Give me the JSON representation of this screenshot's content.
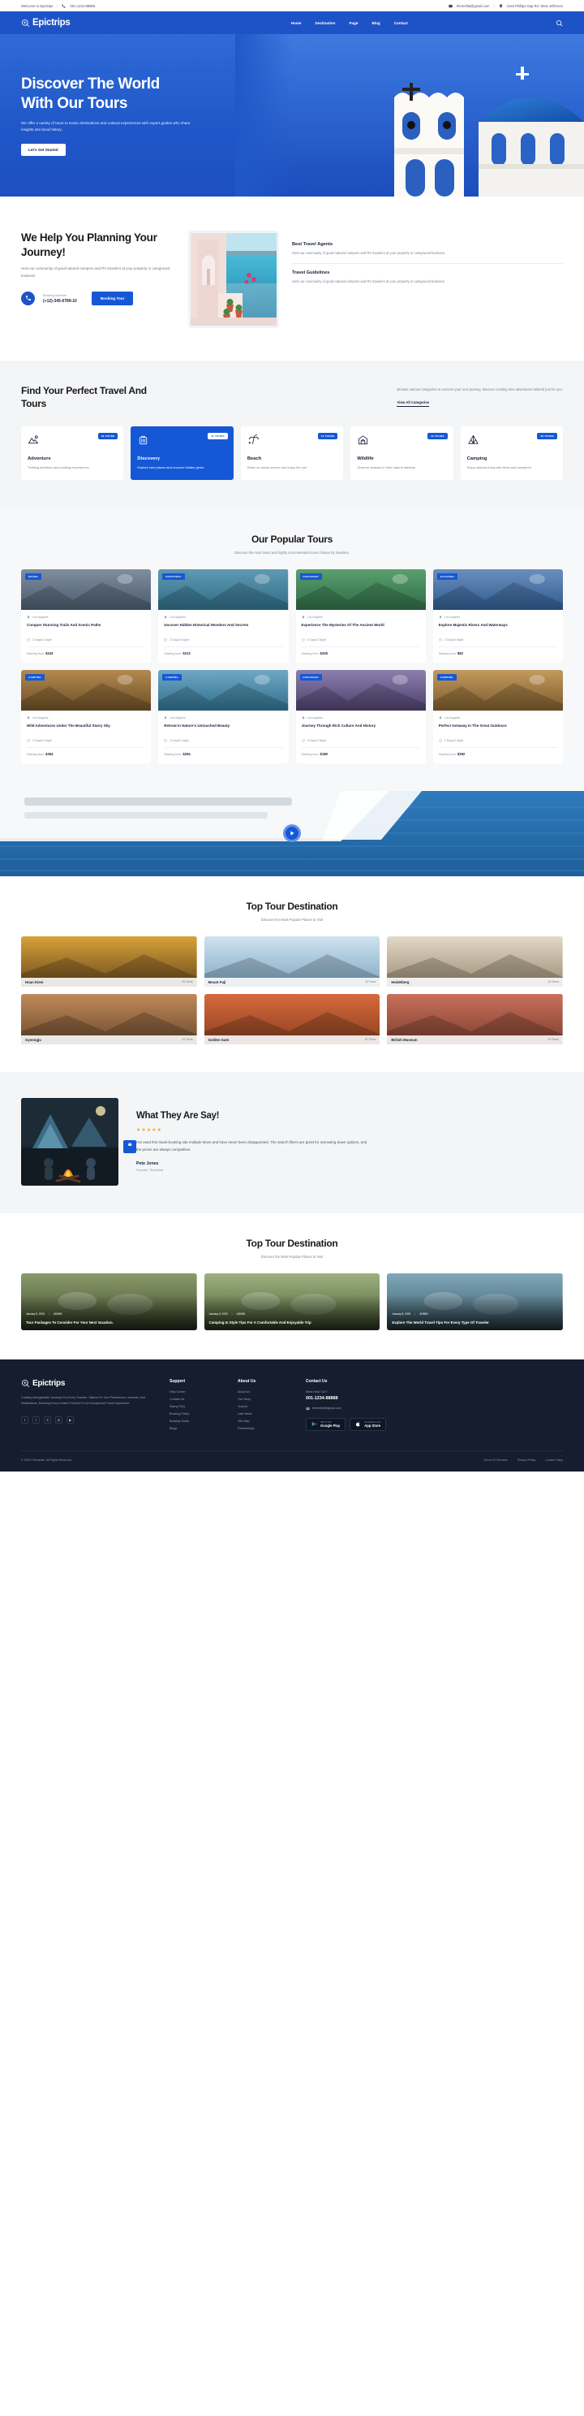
{
  "topbar": {
    "welcome": "Welcome to Epictrips",
    "phone": "001-1234-88888",
    "email": "themeflat@gmail.com",
    "address": "2163 Phillips Gap Rd. West Jefferson"
  },
  "nav": {
    "brand": "Epictrips",
    "links": [
      "Home",
      "Destination",
      "Page",
      "Blog",
      "Contact"
    ]
  },
  "hero": {
    "title_line1": "Discover The World",
    "title_line2": "With Our Tours",
    "subtitle": "We offer a variety of tours to exotic destinations and cultural experiences with expert guides who share insights into local history.",
    "cta": "Let's Get Started"
  },
  "help": {
    "title": "We Help You Planning Your Journey!",
    "body": "Host our community of good-natured campers and RV travelers at your property or camground business",
    "booking_label": "Booking Number",
    "booking_number": "(+12)-345-6789-10",
    "booking_button": "Booking Tour",
    "features": [
      {
        "title": "Best Travel Agents",
        "body": "Host our community of good-natured campers and RV travelers at your property or camground business"
      },
      {
        "title": "Travel Guidelines",
        "body": "Host our community of good-natured campers and RV travelers at your property or camground business"
      }
    ]
  },
  "categories": {
    "title": "Find Your Perfect Travel And Tours",
    "description": "Browse various categories to uncover your next journey, discover exciting new adventures tailored just for you.",
    "view_all": "View All Categories",
    "items": [
      {
        "icon": "mountain-icon",
        "badge": "28 TOURS",
        "title": "Adventure",
        "desc": "Thrilling activities and exciting experiences.",
        "active": false
      },
      {
        "icon": "suitcase-icon",
        "badge": "32 TOURS",
        "title": "Discovery",
        "desc": "Explore new places and uncover hidden gems.",
        "active": true
      },
      {
        "icon": "palm-tree-icon",
        "badge": "12 TOURS",
        "title": "Beach",
        "desc": "Relax on sandy shores and enjoy the sun.",
        "active": false
      },
      {
        "icon": "barn-icon",
        "badge": "42 TOURS",
        "title": "Wildlife",
        "desc": "Observe animals in their natural habitats.",
        "active": false
      },
      {
        "icon": "tent-icon",
        "badge": "48 TOURS",
        "title": "Camping",
        "desc": "Enjoy outdoor living with tents and campfires.",
        "active": false
      }
    ]
  },
  "popular": {
    "title": "Our Popular Tours",
    "subtitle": "Discover the most loved and highly recommended tours chosen by travelers.",
    "tours": [
      {
        "tag": "HIKING",
        "location": "Los Angeles",
        "title": "Conquer Stunning Trails And Scenic Paths",
        "days": "3 Days/2 Night",
        "price_label": "Starting from:",
        "price": "$243"
      },
      {
        "tag": "DISCOVERY",
        "location": "Los Angeles",
        "title": "Uncover Hidden Historical Wonders And Secrets",
        "days": "3 Days/2 Night",
        "price_label": "Starting from:",
        "price": "$213"
      },
      {
        "tag": "DISCOVERY",
        "location": "Los Angeles",
        "title": "Experience The Mysteries Of The Ancient World",
        "days": "3 Days/2 Night",
        "price_label": "Starting from:",
        "price": "$325"
      },
      {
        "tag": "KAYAKING",
        "location": "Los Angeles",
        "title": "Explore Majestic Rivers And Waterways",
        "days": "2 Days/3 Night",
        "price_label": "Starting from:",
        "price": "$82"
      },
      {
        "tag": "CAMPING",
        "location": "Los Angeles",
        "title": "Wild Adventures Under The Beautiful Starry Sky",
        "days": "3 Days/2 Night",
        "price_label": "Starting from:",
        "price": "$354"
      },
      {
        "tag": "CAMPING",
        "location": "Los Angeles",
        "title": "Retreat In Nature's Untouched Beauty",
        "days": "3 Days/2 Night",
        "price_label": "Starting from:",
        "price": "$254"
      },
      {
        "tag": "DISCOVERY",
        "location": "Los Angeles",
        "title": "Journey Through Rich Culture And History",
        "days": "3 Days/2 Night",
        "price_label": "Starting from:",
        "price": "$180"
      },
      {
        "tag": "CAMPING",
        "location": "Los Angeles",
        "title": "Perfect Getaway In The Great Outdoors",
        "days": "2 Days/3 Night",
        "price_label": "Starting from:",
        "price": "$392"
      }
    ]
  },
  "destination": {
    "title": "Top Tour Destination",
    "subtitle": "Discover the Most Popular Places to Visit",
    "items": [
      {
        "name": "Hoan Kiem",
        "count": "26 Tours"
      },
      {
        "name": "Mount Fuji",
        "count": "32 Tours"
      },
      {
        "name": "Heidelberg",
        "count": "42 Tours"
      },
      {
        "name": "Gyeongju",
        "count": "33 Tours"
      },
      {
        "name": "Golden Gate",
        "count": "87 Tours"
      },
      {
        "name": "British Museum",
        "count": "42 Tours"
      }
    ]
  },
  "testimonial": {
    "title": "What They Are Say!",
    "stars": "★★★★★",
    "quote": "I've used this travel booking site multiple times and have never been disappointed. The search filters are great for narrowing down options, and the prices are always competitive.",
    "name": "Pete Jones",
    "role": "Founder, Themeflat",
    "quote_mark": "❝"
  },
  "blog": {
    "title": "Top Tour Destination",
    "subtitle": "Discover the Most Popular Places to Visit",
    "posts": [
      {
        "date": "January 8, 2025",
        "author": "ADMIN",
        "title": "Tour Packages To Consider For Your Next Vacation."
      },
      {
        "date": "January 8, 2025",
        "author": "ADMIN",
        "title": "Camping In Style Tips For A Comfortable And Enjoyable Trip"
      },
      {
        "date": "January 8, 2025",
        "author": "ADMIN",
        "title": "Explore The World Travel Tips For Every Type Of Traveler"
      }
    ]
  },
  "footer": {
    "brand": "Epictrips",
    "about": "Crafting Unforgettable Journeys For Every Traveler. Tailored To Your Preferences, Interests, And Destinations, Ensuring Every Detail Is Perfect For An Exceptional Travel Experience.",
    "social": [
      "facebook-icon",
      "twitter-icon",
      "x-icon",
      "instagram-icon",
      "youtube-icon"
    ],
    "support": {
      "title": "Support",
      "links": [
        "Help Center",
        "Contact Us",
        "Stamp FAQ",
        "Booking Policy",
        "Booking Guide",
        "Blogs"
      ]
    },
    "about_us": {
      "title": "About Us",
      "links": [
        "About Us",
        "Our Story",
        "Journal",
        "Late News",
        "Site Map",
        "Partnerships"
      ]
    },
    "contact": {
      "title": "Contact Us",
      "need_help": "Need Help? 24/7",
      "phone": "001-1234-88888",
      "email": "themeflat@gmail.com",
      "stores": [
        {
          "small": "GET IT ON",
          "big": "Google Play"
        },
        {
          "small": "Download on the",
          "big": "App Store"
        }
      ]
    },
    "copyright": "© 2025 Themeflat. All Rights Reserved.",
    "bottom_links": [
      "Terms Of Services",
      "Privacy Policy",
      "Cookie Policy"
    ]
  },
  "colors": {
    "brand": "#1558d6",
    "dark": "#151d2e",
    "accent": "#f5a623"
  }
}
